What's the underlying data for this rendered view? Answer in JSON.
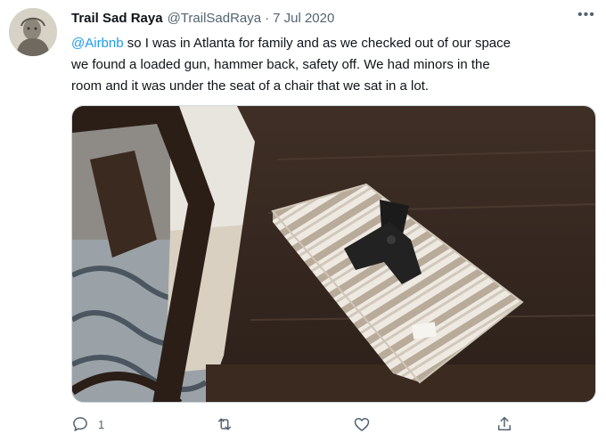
{
  "tweet": {
    "display_name": "Trail Sad Raya",
    "handle": "@TrailSadRaya",
    "separator": "·",
    "date": "7 Jul 2020",
    "more_label": "•••",
    "text_mention": "@Airbnb",
    "text_line1_rest": " so I was in Atlanta for family and as we checked out of our space",
    "text_line2": "we found a loaded gun, hammer back, safety off. We had minors in the",
    "text_line3": "room and it was under the seat of a chair that we sat in a lot.",
    "actions": {
      "reply_count": "1",
      "retweet_count": "",
      "like_count": "",
      "icons": [
        "reply-icon",
        "retweet-icon",
        "like-icon",
        "share-icon"
      ]
    }
  },
  "colors": {
    "link": "#1d9bf0",
    "secondary_text": "#536471",
    "primary_text": "#0f1419"
  }
}
